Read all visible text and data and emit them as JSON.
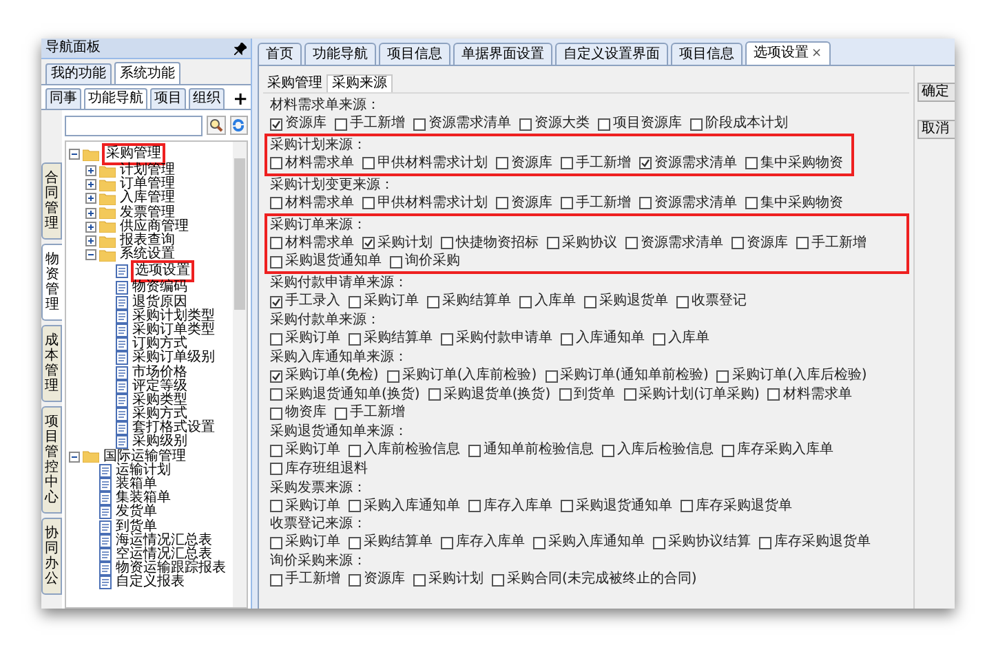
{
  "nav_panel": {
    "title": "导航面板",
    "tabs": [
      {
        "label": "我的功能",
        "selected": false
      },
      {
        "label": "系统功能",
        "selected": true
      }
    ],
    "subtabs": [
      {
        "label": "同事",
        "selected": false
      },
      {
        "label": "功能导航",
        "selected": true
      },
      {
        "label": "项目",
        "selected": false
      },
      {
        "label": "组织",
        "selected": false
      }
    ],
    "add_button": "+",
    "side_tabs": [
      {
        "label": "合同管理",
        "selected": false
      },
      {
        "label": "物资管理",
        "selected": true
      },
      {
        "label": "成本管理",
        "selected": false
      },
      {
        "label": "项目管控中心",
        "selected": false
      },
      {
        "label": "协同办公",
        "selected": false
      }
    ],
    "tree": [
      {
        "label": "采购管理",
        "kind": "folder",
        "expanded": true,
        "annotated": true,
        "children": [
          {
            "label": "计划管理",
            "kind": "folder",
            "expanded": false
          },
          {
            "label": "订单管理",
            "kind": "folder",
            "expanded": false
          },
          {
            "label": "入库管理",
            "kind": "folder",
            "expanded": false
          },
          {
            "label": "发票管理",
            "kind": "folder",
            "expanded": false
          },
          {
            "label": "供应商管理",
            "kind": "folder",
            "expanded": false
          },
          {
            "label": "报表查询",
            "kind": "folder",
            "expanded": false
          },
          {
            "label": "系统设置",
            "kind": "folder",
            "expanded": true,
            "children": [
              {
                "label": "选项设置",
                "kind": "doc",
                "annotated": true
              },
              {
                "label": "物资编码",
                "kind": "doc"
              },
              {
                "label": "退货原因",
                "kind": "doc"
              },
              {
                "label": "采购计划类型",
                "kind": "doc"
              },
              {
                "label": "采购订单类型",
                "kind": "doc"
              },
              {
                "label": "订购方式",
                "kind": "doc"
              },
              {
                "label": "采购订单级别",
                "kind": "doc"
              },
              {
                "label": "市场价格",
                "kind": "doc"
              },
              {
                "label": "评定等级",
                "kind": "doc"
              },
              {
                "label": "采购类型",
                "kind": "doc"
              },
              {
                "label": "采购方式",
                "kind": "doc"
              },
              {
                "label": "套打格式设置",
                "kind": "doc"
              },
              {
                "label": "采购级别",
                "kind": "doc"
              }
            ]
          }
        ]
      },
      {
        "label": "国际运输管理",
        "kind": "folder",
        "expanded": true,
        "children": [
          {
            "label": "运输计划",
            "kind": "doc"
          },
          {
            "label": "装箱单",
            "kind": "doc"
          },
          {
            "label": "集装箱单",
            "kind": "doc"
          },
          {
            "label": "发货单",
            "kind": "doc"
          },
          {
            "label": "到货单",
            "kind": "doc"
          },
          {
            "label": "海运情况汇总表",
            "kind": "doc"
          },
          {
            "label": "空运情况汇总表",
            "kind": "doc"
          },
          {
            "label": "物资运输跟踪报表",
            "kind": "doc"
          },
          {
            "label": "自定义报表",
            "kind": "doc"
          }
        ]
      }
    ]
  },
  "tabs": [
    {
      "label": "首页",
      "selected": false
    },
    {
      "label": "功能导航",
      "selected": false
    },
    {
      "label": "项目信息",
      "selected": false
    },
    {
      "label": "单据界面设置",
      "selected": false
    },
    {
      "label": "自定义设置界面",
      "selected": false
    },
    {
      "label": "项目信息",
      "selected": false
    },
    {
      "label": "选项设置",
      "selected": true,
      "close": "×"
    }
  ],
  "subtabs": [
    {
      "label": "采购管理",
      "selected": false
    },
    {
      "label": "采购来源",
      "selected": true
    }
  ],
  "buttons": [
    "确定",
    "取消"
  ],
  "sections": [
    {
      "label": "材料需求单来源：",
      "options": [
        {
          "label": "资源库",
          "checked": true
        },
        {
          "label": "手工新增",
          "checked": false
        },
        {
          "label": "资源需求清单",
          "checked": false
        },
        {
          "label": "资源大类",
          "checked": false
        },
        {
          "label": "项目资源库",
          "checked": false
        },
        {
          "label": "阶段成本计划",
          "checked": false
        }
      ]
    },
    {
      "label": "采购计划来源：",
      "annotated": true,
      "options": [
        {
          "label": "材料需求单",
          "checked": false
        },
        {
          "label": "甲供材料需求计划",
          "checked": false
        },
        {
          "label": "资源库",
          "checked": false
        },
        {
          "label": "手工新增",
          "checked": false
        },
        {
          "label": "资源需求清单",
          "checked": true
        },
        {
          "label": "集中采购物资",
          "checked": false
        }
      ]
    },
    {
      "label": "采购计划变更来源：",
      "options": [
        {
          "label": "材料需求单",
          "checked": false
        },
        {
          "label": "甲供材料需求计划",
          "checked": false
        },
        {
          "label": "资源库",
          "checked": false
        },
        {
          "label": "手工新增",
          "checked": false
        },
        {
          "label": "资源需求清单",
          "checked": false
        },
        {
          "label": "集中采购物资",
          "checked": false
        }
      ]
    },
    {
      "label": "采购订单来源：",
      "annotated": true,
      "options": [
        {
          "label": "材料需求单",
          "checked": false
        },
        {
          "label": "采购计划",
          "checked": true
        },
        {
          "label": "快捷物资招标",
          "checked": false
        },
        {
          "label": "采购协议",
          "checked": false
        },
        {
          "label": "资源需求清单",
          "checked": false
        },
        {
          "label": "资源库",
          "checked": false
        },
        {
          "label": "手工新增",
          "checked": false
        },
        {
          "label": "采购退货通知单",
          "checked": false
        },
        {
          "label": "询价采购",
          "checked": false
        }
      ]
    },
    {
      "label": "采购付款申请单来源：",
      "options": [
        {
          "label": "手工录入",
          "checked": true
        },
        {
          "label": "采购订单",
          "checked": false
        },
        {
          "label": "采购结算单",
          "checked": false
        },
        {
          "label": "入库单",
          "checked": false
        },
        {
          "label": "采购退货单",
          "checked": false
        },
        {
          "label": "收票登记",
          "checked": false
        }
      ]
    },
    {
      "label": "采购付款单来源：",
      "options": [
        {
          "label": "采购订单",
          "checked": false
        },
        {
          "label": "采购结算单",
          "checked": false
        },
        {
          "label": "采购付款申请单",
          "checked": false
        },
        {
          "label": "入库通知单",
          "checked": false
        },
        {
          "label": "入库单",
          "checked": false
        }
      ]
    },
    {
      "label": "采购入库通知单来源：",
      "options": [
        {
          "label": "采购订单(免检)",
          "checked": true
        },
        {
          "label": "采购订单(入库前检验)",
          "checked": false
        },
        {
          "label": "采购订单(通知单前检验)",
          "checked": false
        },
        {
          "label": "采购订单(入库后检验)",
          "checked": false
        },
        {
          "label": "采购退货通知单(换货)",
          "checked": false
        },
        {
          "label": "采购退货单(换货)",
          "checked": false
        },
        {
          "label": "到货单",
          "checked": false
        },
        {
          "label": "采购计划(订单采购)",
          "checked": false
        },
        {
          "label": "材料需求单",
          "checked": false
        },
        {
          "label": "物资库",
          "checked": false
        },
        {
          "label": "手工新增",
          "checked": false
        }
      ]
    },
    {
      "label": "采购退货通知单来源：",
      "options": [
        {
          "label": "采购订单",
          "checked": false
        },
        {
          "label": "入库前检验信息",
          "checked": false
        },
        {
          "label": "通知单前检验信息",
          "checked": false
        },
        {
          "label": "入库后检验信息",
          "checked": false
        },
        {
          "label": "库存采购入库单",
          "checked": false
        },
        {
          "label": "库存班组退料",
          "checked": false
        }
      ]
    },
    {
      "label": "采购发票来源：",
      "options": [
        {
          "label": "采购订单",
          "checked": false
        },
        {
          "label": "采购入库通知单",
          "checked": false
        },
        {
          "label": "库存入库单",
          "checked": false
        },
        {
          "label": "采购退货通知单",
          "checked": false
        },
        {
          "label": "库存采购退货单",
          "checked": false
        }
      ]
    },
    {
      "label": "收票登记来源：",
      "options": [
        {
          "label": "采购订单",
          "checked": false
        },
        {
          "label": "采购结算单",
          "checked": false
        },
        {
          "label": "库存入库单",
          "checked": false
        },
        {
          "label": "采购入库通知单",
          "checked": false
        },
        {
          "label": "采购协议结算",
          "checked": false
        },
        {
          "label": "库存采购退货单",
          "checked": false
        }
      ]
    },
    {
      "label": "询价采购来源：",
      "options": [
        {
          "label": "手工新增",
          "checked": false
        },
        {
          "label": "资源库",
          "checked": false
        },
        {
          "label": "采购计划",
          "checked": false
        },
        {
          "label": "采购合同(未完成被终止的合同)",
          "checked": false
        }
      ]
    }
  ]
}
